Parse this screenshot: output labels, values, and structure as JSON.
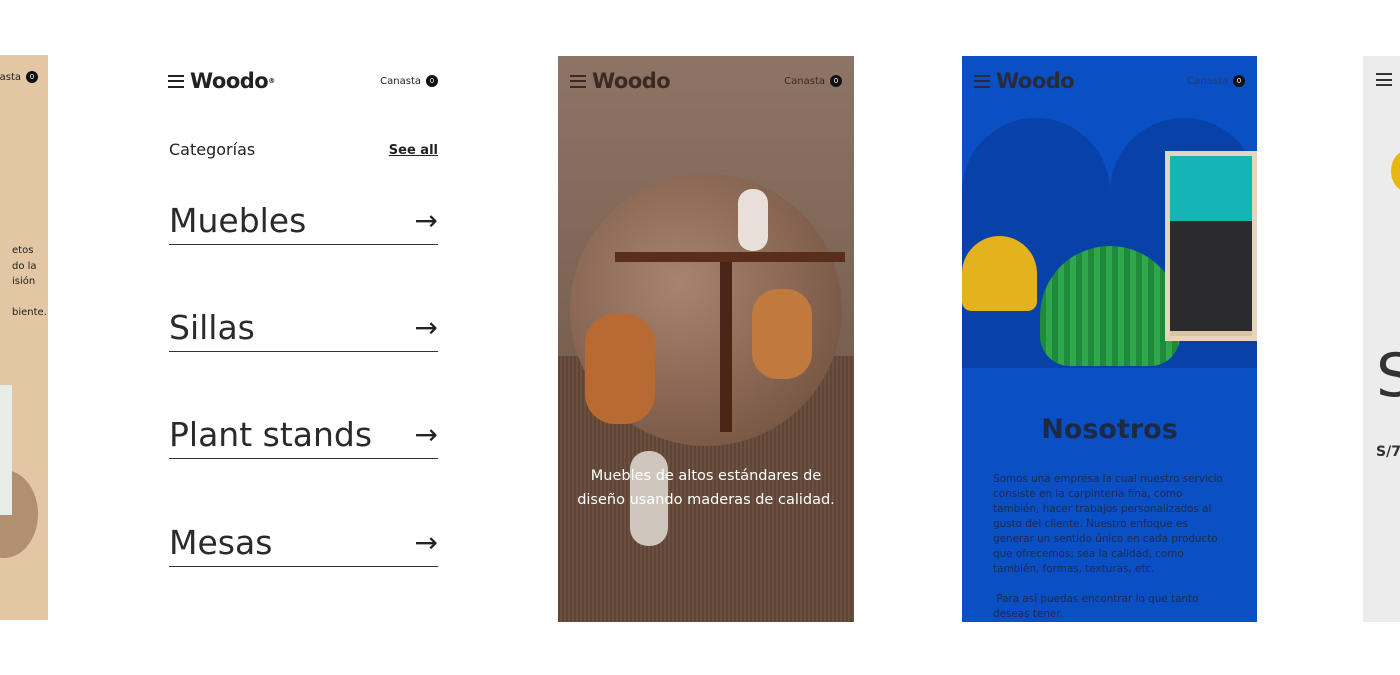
{
  "brand": {
    "name": "Woodo",
    "registered": "®"
  },
  "cart": {
    "label": "Canasta",
    "count": "0"
  },
  "frame1": {
    "cart_label_partial": "asta",
    "count": "0",
    "text_lines": [
      "etos",
      "do la",
      "isión",
      "",
      "biente."
    ],
    "bg": "#e3c6a3"
  },
  "categories": {
    "title": "Categorías",
    "see_all": "See all",
    "items": [
      {
        "label": "Muebles"
      },
      {
        "label": "Sillas"
      },
      {
        "label": "Plant stands"
      },
      {
        "label": "Mesas"
      }
    ]
  },
  "hero": {
    "caption_line1": "Muebles de altos estándares de",
    "caption_line2": "diseño usando maderas de calidad."
  },
  "about": {
    "title": "Nosotros",
    "paragraph1": "Somos una empresa la cual nuestro servicio consiste en la carpintería fina, como también, hacer trabajos personalizados al gusto del cliente. Nuestro enfoque es generar un sentido único en cada producto que ofrecemos; sea la calidad, como también, formas, texturas, etc.",
    "paragraph2": " Para así puedas encontrar lo que tanto deseas tener.",
    "bg": "#0a4fc3"
  },
  "frame5": {
    "big_letter": "S",
    "price_partial": "S/7"
  }
}
